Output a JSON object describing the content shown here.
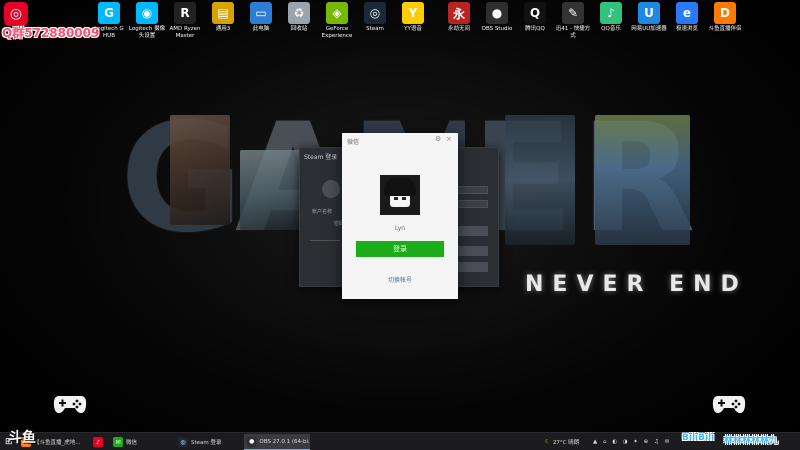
{
  "overlay": {
    "qq_watermark": "Q群572880009"
  },
  "desktop_icons_left": [
    {
      "label": "Logitech G HUB",
      "icon": "logitech-g-hub-icon",
      "color": "#00b8fc",
      "glyph": "G"
    },
    {
      "label": "Logitech 摄像头设置",
      "icon": "logitech-camera-icon",
      "color": "#00b8fc",
      "glyph": "◉"
    },
    {
      "label": "AMD Ryzen Master",
      "icon": "amd-ryzen-icon",
      "color": "#222",
      "glyph": "R"
    },
    {
      "label": "通用3",
      "icon": "document-icon",
      "color": "#d6a300",
      "glyph": "▤"
    },
    {
      "label": "此电脑",
      "icon": "computer-icon",
      "color": "#2d7dd2",
      "glyph": "▭"
    },
    {
      "label": "回收站",
      "icon": "recycle-bin-icon",
      "color": "#9aa4ad",
      "glyph": "♻"
    },
    {
      "label": "GeForce Experience",
      "icon": "geforce-icon",
      "color": "#76b900",
      "glyph": "◈"
    },
    {
      "label": "Steam",
      "icon": "steam-icon",
      "color": "#1b2838",
      "glyph": "◎"
    },
    {
      "label": "YY语音",
      "icon": "yy-icon",
      "color": "#ffcc00",
      "glyph": "Y"
    }
  ],
  "desktop_icons_right": [
    {
      "label": "永劫无间",
      "icon": "naraka-icon",
      "color": "#b22",
      "glyph": "永"
    },
    {
      "label": "OBS Studio",
      "icon": "obs-icon",
      "color": "#302e31",
      "glyph": "●"
    },
    {
      "label": "腾讯QQ",
      "icon": "qq-icon",
      "color": "#111",
      "glyph": "Q"
    },
    {
      "label": "迅41 - 快捷方式",
      "icon": "shortcut-icon",
      "color": "#333",
      "glyph": "✎"
    },
    {
      "label": "QQ音乐",
      "icon": "qq-music-icon",
      "color": "#31c27c",
      "glyph": "♪"
    },
    {
      "label": "网易UU加速器",
      "icon": "uu-icon",
      "color": "#1e88e5",
      "glyph": "U"
    },
    {
      "label": "极速浏览",
      "icon": "browser-icon",
      "color": "#2979ff",
      "glyph": "e"
    },
    {
      "label": "斗鱼直播伴侣",
      "icon": "douyu-icon",
      "color": "#ff7a00",
      "glyph": "D"
    }
  ],
  "wallpaper": {
    "letters": [
      "G",
      "A",
      "M",
      "E",
      "R"
    ],
    "tagline": "NEVER END"
  },
  "steam_window": {
    "title": "Steam 登录",
    "account_label": "帐户名称",
    "password_label": "密码"
  },
  "wechat_dialog": {
    "title": "微信",
    "username": "Lyn",
    "login_button": "登录",
    "switch_account": "切换帐号",
    "settings_glyph": "⚙",
    "close_glyph": "×"
  },
  "taskbar": {
    "start_glyph": "⊞",
    "items": [
      {
        "label": "【斗鱼直播_虎地...",
        "icon": "douyu-tb-icon",
        "color": "#ff7a00",
        "glyph": "斗",
        "active": false
      },
      {
        "label": "",
        "icon": "netease-tb-icon",
        "color": "#e60026",
        "glyph": "♪",
        "active": false
      },
      {
        "label": "微信",
        "icon": "wechat-tb-icon",
        "color": "#1aad19",
        "glyph": "✉",
        "active": false
      },
      {
        "label": "Steam 登录",
        "icon": "steam-tb-icon",
        "color": "#1b2838",
        "glyph": "◎",
        "active": false
      },
      {
        "label": "OBS 27.0.1 (64-bi...",
        "icon": "obs-tb-icon",
        "color": "#302e31",
        "glyph": "●",
        "active": true
      }
    ],
    "weather": "27°C 晴朗",
    "tray_glyphs": "▲ ⌂ ◐ ◑ ✦ ⊕ ♫ ✉",
    "bilibili": "BiliBili",
    "bilibili_user": "林林林林林九"
  },
  "douyu_logo": "斗鱼"
}
